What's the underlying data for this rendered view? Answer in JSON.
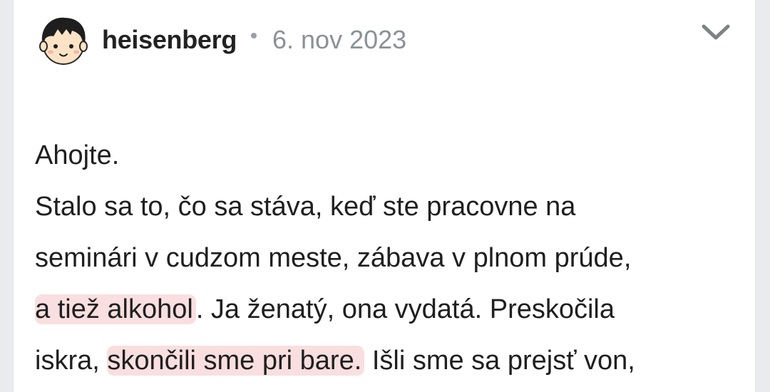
{
  "post": {
    "author": "heisenberg",
    "separator": "•",
    "date": "6. nov 2023",
    "menu_icon": "chevron-down-icon",
    "avatar_icon": "cartoon-boy-avatar",
    "body": {
      "line1": "Ahojte.",
      "line2": "Stalo sa to, čo sa stáva, keď ste pracovne na",
      "line3": "seminári v cudzom meste, zábava v plnom prúde,",
      "line4_hl": "a tiež alkohol",
      "line4_rest": ". Ja ženatý, ona vydatá. Preskočila",
      "line5_pre": "iskra, ",
      "line5_hl": "skončili sme pri bare.",
      "line5_rest": " Išli sme sa prejsť von,"
    }
  },
  "colors": {
    "highlight": "#f4c4c4",
    "date_text": "#8c9196",
    "author_text": "#222222"
  }
}
